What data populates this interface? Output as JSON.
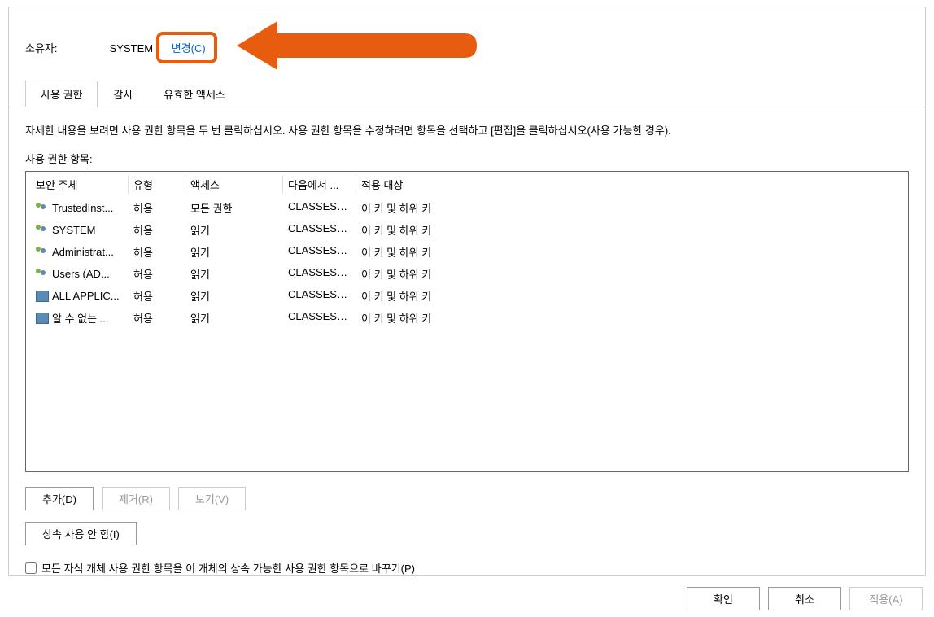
{
  "owner": {
    "label": "소유자:",
    "value": "SYSTEM",
    "change_link": "변경(C)"
  },
  "tabs": {
    "permissions": "사용 권한",
    "auditing": "감사",
    "effective_access": "유효한 액세스"
  },
  "instruction": "자세한 내용을 보려면 사용 권한 항목을 두 번 클릭하십시오. 사용 권한 항목을 수정하려면 항목을 선택하고 [편집]을 클릭하십시오(사용 가능한 경우).",
  "list_label": "사용 권한 항목:",
  "columns": {
    "principal": "보안 주체",
    "type": "유형",
    "access": "액세스",
    "inherited_from": "다음에서 ...",
    "applies_to": "적용 대상"
  },
  "entries": [
    {
      "icon": "users",
      "principal": "TrustedInst...",
      "type": "허용",
      "access": "모든 권한",
      "from": "CLASSES_...",
      "applies": "이 키 및 하위 키"
    },
    {
      "icon": "users",
      "principal": "SYSTEM",
      "type": "허용",
      "access": "읽기",
      "from": "CLASSES_...",
      "applies": "이 키 및 하위 키"
    },
    {
      "icon": "users",
      "principal": "Administrat...",
      "type": "허용",
      "access": "읽기",
      "from": "CLASSES_...",
      "applies": "이 키 및 하위 키"
    },
    {
      "icon": "users",
      "principal": "Users (AD...",
      "type": "허용",
      "access": "읽기",
      "from": "CLASSES_...",
      "applies": "이 키 및 하위 키"
    },
    {
      "icon": "package",
      "principal": "ALL APPLIC...",
      "type": "허용",
      "access": "읽기",
      "from": "CLASSES_...",
      "applies": "이 키 및 하위 키"
    },
    {
      "icon": "package",
      "principal": "알 수 없는 ...",
      "type": "허용",
      "access": "읽기",
      "from": "CLASSES_...",
      "applies": "이 키 및 하위 키"
    }
  ],
  "buttons": {
    "add": "추가(D)",
    "remove": "제거(R)",
    "view": "보기(V)",
    "disable_inheritance": "상속 사용 안 함(I)"
  },
  "checkbox_label": "모든 자식 개체 사용 권한 항목을 이 개체의 상속 가능한 사용 권한 항목으로 바꾸기(P)",
  "footer": {
    "ok": "확인",
    "cancel": "취소",
    "apply": "적용(A)"
  }
}
